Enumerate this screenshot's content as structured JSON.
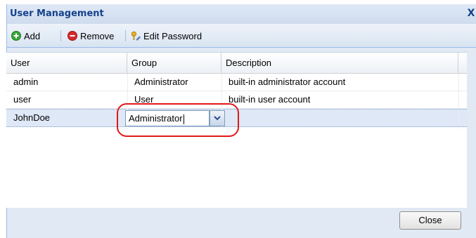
{
  "window": {
    "title": "User Management",
    "close_glyph": "X"
  },
  "toolbar": {
    "add_label": "Add",
    "remove_label": "Remove",
    "edit_password_label": "Edit Password"
  },
  "grid": {
    "columns": [
      "User",
      "Group",
      "Description"
    ],
    "rows": [
      {
        "user": "admin",
        "group": "Administrator",
        "description": "built-in administrator account"
      },
      {
        "user": "user",
        "group": "User",
        "description": "built-in user account"
      },
      {
        "user": "JohnDoe",
        "group": "",
        "description": ""
      }
    ]
  },
  "editor": {
    "value": "Administrator"
  },
  "footer": {
    "close_label": "Close"
  },
  "colors": {
    "title": "#15428b",
    "highlight": "#e01818",
    "selected_row": "#dfe8f6"
  }
}
